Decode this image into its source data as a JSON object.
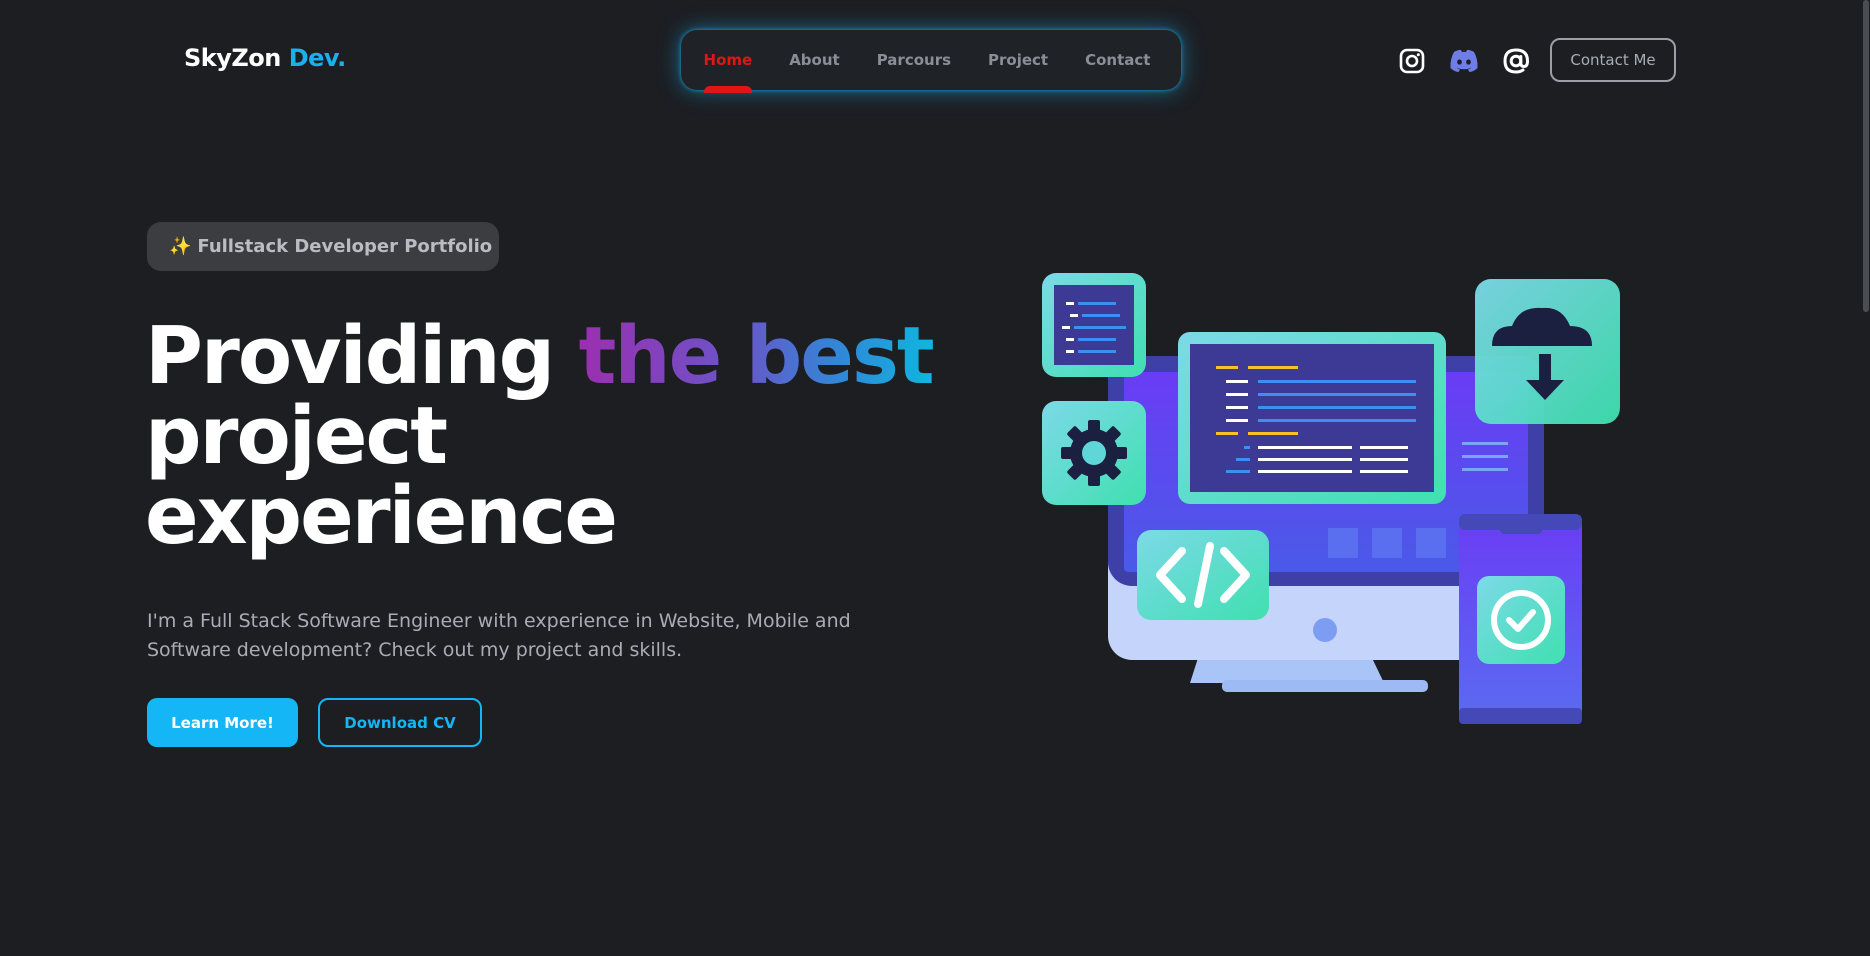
{
  "header": {
    "logo_main": "SkyZon",
    "logo_accent": "Dev.",
    "nav": [
      {
        "label": "Home",
        "active": true
      },
      {
        "label": "About",
        "active": false
      },
      {
        "label": "Parcours",
        "active": false
      },
      {
        "label": "Project",
        "active": false
      },
      {
        "label": "Contact",
        "active": false
      }
    ],
    "socials": [
      {
        "icon": "instagram-icon"
      },
      {
        "icon": "discord-icon"
      },
      {
        "icon": "at-sign-icon"
      }
    ],
    "contact_button": "Contact Me"
  },
  "hero": {
    "badge_icon": "✨",
    "badge_text": "Fullstack Developer Portfolio",
    "headline_start": "Providing ",
    "headline_highlight": "the best",
    "headline_line2": "project",
    "headline_line3": "experience",
    "description": "I'm a Full Stack Software Engineer with experience in Website, Mobile and Software development? Check out my project and skills.",
    "primary_button": "Learn More!",
    "secondary_button": "Download CV"
  },
  "colors": {
    "background": "#1c1e22",
    "accent": "#14b6f5",
    "active_nav": "#e01616"
  }
}
